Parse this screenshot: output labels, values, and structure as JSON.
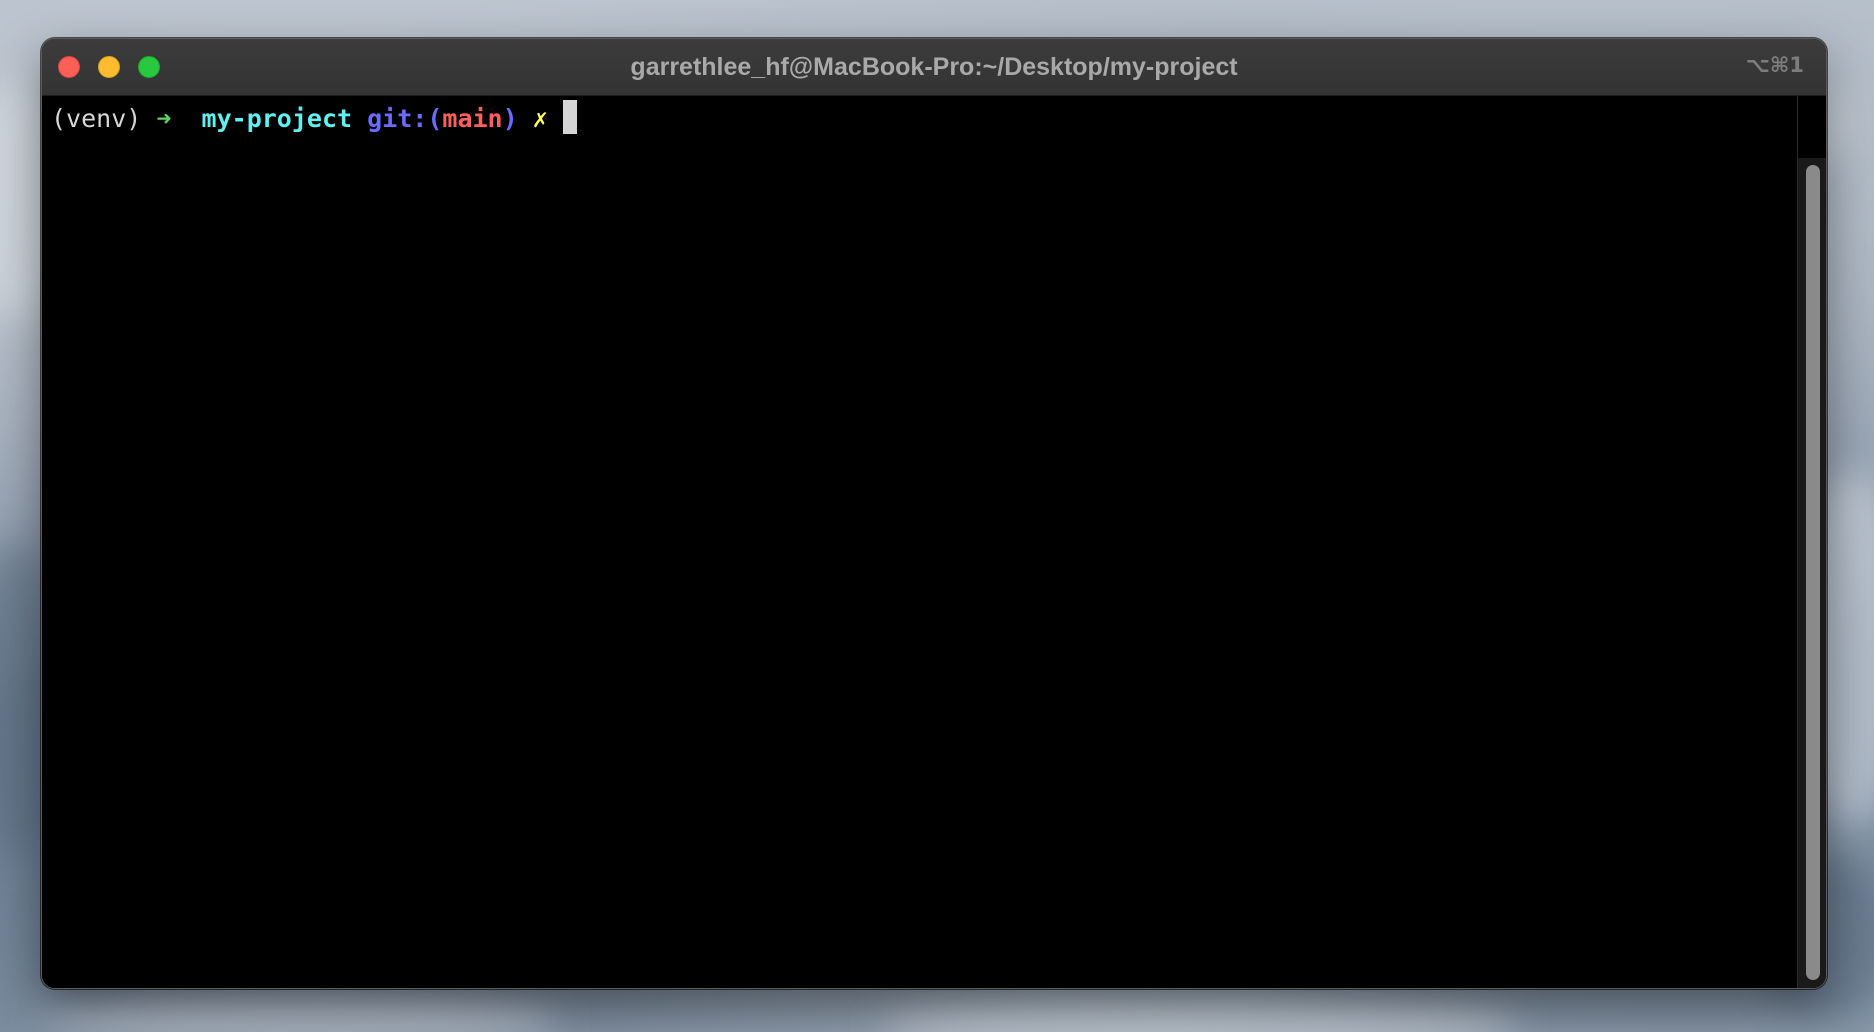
{
  "window": {
    "title": "garrethlee_hf@MacBook-Pro:~/Desktop/my-project",
    "shortcut": "⌥⌘1"
  },
  "prompt": {
    "venv": "(venv)",
    "arrow": "➜",
    "directory": "my-project",
    "git_label": "git:",
    "git_open": "(",
    "branch": "main",
    "git_close": ")",
    "dirty_marker": "✗"
  },
  "colors": {
    "venv": "#d6d6d6",
    "arrow": "#5fd75f",
    "directory": "#5ff0f0",
    "git_label": "#6b6bff",
    "branch": "#ff5f5f",
    "dirty_marker": "#ffff5f"
  },
  "icons": {
    "close": "close-icon",
    "minimize": "minimize-icon",
    "zoom": "zoom-icon"
  }
}
